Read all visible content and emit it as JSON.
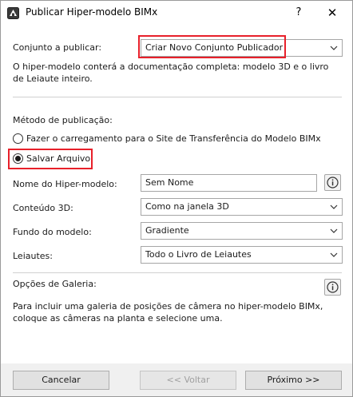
{
  "window": {
    "title": "Publicar Hiper-modelo BIMx",
    "help_label": "?",
    "close_label": "✕",
    "app_icon": "bimx-app-icon"
  },
  "publisher_set": {
    "label": "Conjunto a publicar:",
    "value": "Criar Novo Conjunto Publicador",
    "description": "O hiper-modelo conterá a documentação completa: modelo 3D e o livro de Leiaute inteiro."
  },
  "publish_method": {
    "label": "Método de publicação:",
    "options": [
      {
        "label": "Fazer o carregamento para o Site de Transferência do Modelo BIMx",
        "selected": false
      },
      {
        "label": "Salvar Arquivo",
        "selected": true
      }
    ]
  },
  "fields": {
    "name_label": "Nome do Hiper-modelo:",
    "name_value": "Sem Nome",
    "content3d_label": "Conteúdo 3D:",
    "content3d_value": "Como na janela 3D",
    "background_label": "Fundo do modelo:",
    "background_value": "Gradiente",
    "layouts_label": "Leiautes:",
    "layouts_value": "Todo o Livro de Leiautes"
  },
  "gallery": {
    "label": "Opções de Galeria:",
    "description": "Para incluir uma galeria de posições de câmera no hiper-modelo BIMx, coloque as câmeras na planta e selecione uma."
  },
  "footer": {
    "cancel_label": "Cancelar",
    "back_label": "<< Voltar",
    "next_label": "Próximo >>"
  },
  "colors": {
    "highlight": "#e8202a",
    "info_icon": "#333333"
  }
}
